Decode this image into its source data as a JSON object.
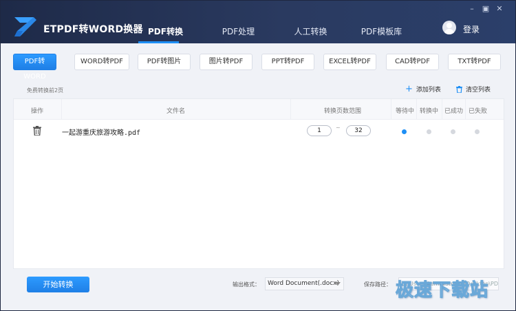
{
  "app": {
    "title": "ETPDF转WORD换器",
    "login": "登录",
    "window_controls": {
      "minimize": "–",
      "restore": "▣",
      "close": "✕"
    }
  },
  "nav": {
    "tabs": [
      {
        "label": "PDF转换",
        "active": true
      },
      {
        "label": "PDF处理",
        "active": false
      },
      {
        "label": "人工转换",
        "active": false
      },
      {
        "label": "PDF模板库",
        "active": false
      }
    ]
  },
  "subtabs": [
    {
      "label": "PDF转WORD",
      "active": true
    },
    {
      "label": "WORD转PDF",
      "active": false
    },
    {
      "label": "PDF转图片",
      "active": false
    },
    {
      "label": "图片转PDF",
      "active": false
    },
    {
      "label": "PPT转PDF",
      "active": false
    },
    {
      "label": "EXCEL转PDF",
      "active": false
    },
    {
      "label": "CAD转PDF",
      "active": false
    },
    {
      "label": "TXT转PDF",
      "active": false
    }
  ],
  "toolbar": {
    "free_note": "免费转换前2页",
    "add_list": "添加列表",
    "clear_list": "清空列表"
  },
  "table": {
    "headers": {
      "operation": "操作",
      "filename": "文件名",
      "page_range": "转换页数范围",
      "waiting": "等待中",
      "converting": "转换中",
      "success": "已成功",
      "failed": "已失败"
    },
    "rows": [
      {
        "filename": "一起游重庆旅游攻略.pdf",
        "page_start": "1",
        "page_end": "32",
        "range_separator": "~",
        "status": "waiting"
      }
    ]
  },
  "bottom": {
    "start_button": "开始转换",
    "format_label": "输出格式：",
    "format_value": "Word Document(.docx)",
    "path_label": "保存路径：",
    "path_value": "C:\\Users\\Administrator\\Desktop\\PDF转换"
  },
  "watermark": "极速下载站",
  "colors": {
    "accent": "#1e8ff5",
    "header": "#1e2a48",
    "dot_inactive": "#d5d8de"
  }
}
